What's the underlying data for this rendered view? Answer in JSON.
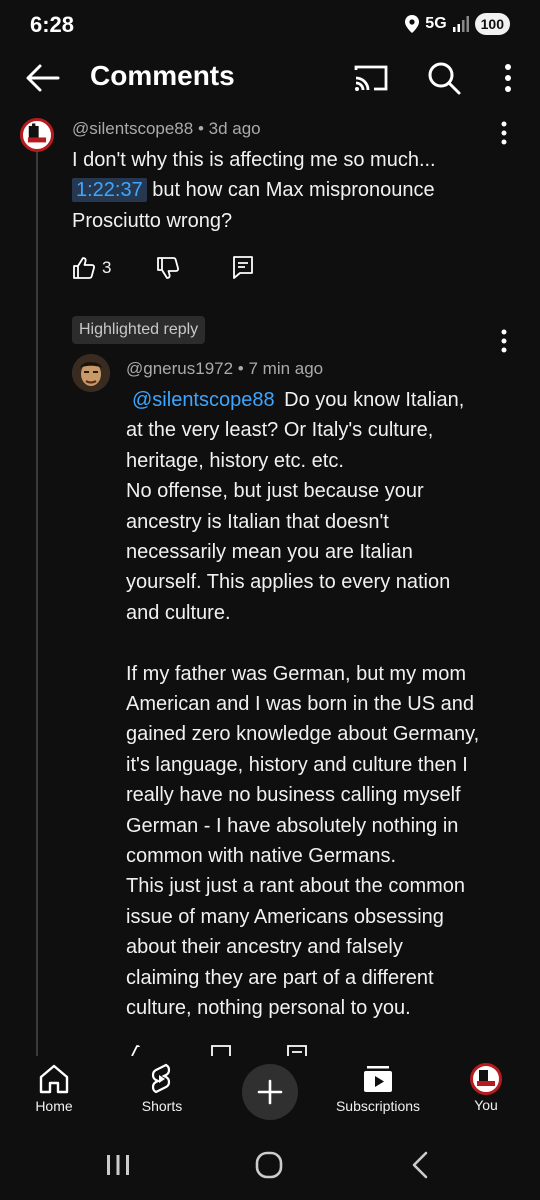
{
  "status_bar": {
    "time": "6:28",
    "network": "5G",
    "battery": "100"
  },
  "app_bar": {
    "title": "Comments",
    "back_icon": "arrow-left-icon",
    "cast_icon": "cast-icon",
    "search_icon": "search-icon",
    "more_icon": "more-vert-icon"
  },
  "comment": {
    "author": "@silentscope88",
    "age": "3d ago",
    "line1": "I don't why this is affecting me so much...",
    "timestamp": "1:22:37",
    "line2_after_timestamp": " but how can Max mispronounce",
    "line3": "Prosciutto wrong?",
    "likes": "3"
  },
  "reply": {
    "chip": "Highlighted reply",
    "author": "@gnerus1972",
    "age": "7 min ago",
    "mention": "@silentscope88",
    "lines": [
      " Do you know Italian,",
      "at the very least? Or Italy's culture,",
      "heritage, history etc. etc.",
      "No offense, but just because your",
      "ancestry is Italian that doesn't",
      "necessarily mean you are Italian",
      "yourself. This applies to every nation",
      "and culture.",
      "",
      "If my father was German, but my mom",
      "American and I was born in the US and",
      "gained zero knowledge about Germany,",
      "it's language, history and culture then I",
      "really have no business calling myself",
      "German - I have absolutely nothing in",
      "common with native Germans.",
      "This just just a rant about the common",
      "issue of many Americans obsessing",
      "about their ancestry and falsely",
      "claiming they are part of a different",
      "culture, nothing personal to you."
    ]
  },
  "bottom_nav": [
    {
      "label": "Home",
      "icon": "home-icon"
    },
    {
      "label": "Shorts",
      "icon": "shorts-icon"
    },
    {
      "label": "",
      "icon": "create-plus-icon"
    },
    {
      "label": "Subscriptions",
      "icon": "subscriptions-icon"
    },
    {
      "label": "You",
      "icon": "profile-avatar-icon"
    }
  ],
  "colors": {
    "background": "#0f0f0f",
    "link": "#3ea6ff",
    "timestamp_bg": "#263850",
    "secondary_text": "#aaaaaa"
  }
}
